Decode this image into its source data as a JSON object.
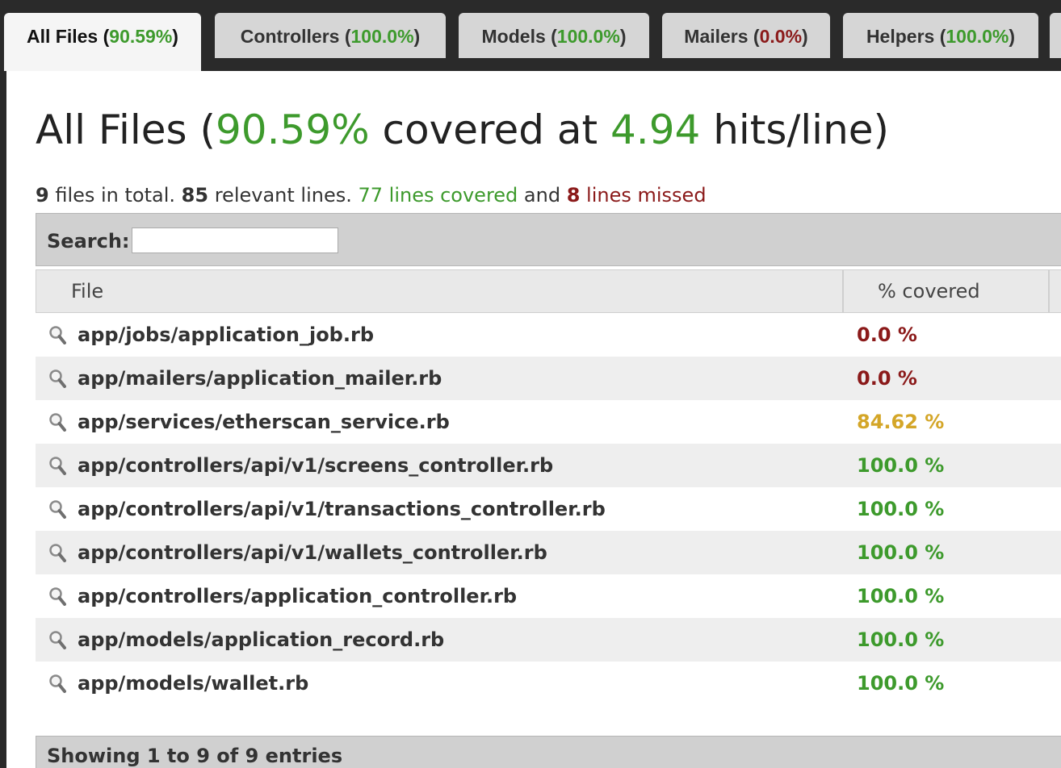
{
  "tabs": [
    {
      "label": "All Files (",
      "pct": "90.59%",
      "close": ")",
      "status": "green"
    },
    {
      "label": "Controllers (",
      "pct": "100.0%",
      "close": ")",
      "status": "green"
    },
    {
      "label": "Models (",
      "pct": "100.0%",
      "close": ")",
      "status": "green"
    },
    {
      "label": "Mailers (",
      "pct": "0.0%",
      "close": ")",
      "status": "red"
    },
    {
      "label": "Helpers (",
      "pct": "100.0%",
      "close": ")",
      "status": "green"
    }
  ],
  "title": {
    "prefix": "All Files (",
    "covered_pct": "90.59%",
    "mid": " covered at ",
    "hits": "4.94",
    "suffix": " hits/line)"
  },
  "summary": {
    "files_count": "9",
    "files_text": " files in total. ",
    "relevant_count": "85",
    "relevant_text": " relevant lines. ",
    "covered_text": "77 lines covered",
    "and_text": " and ",
    "missed_count": "8",
    "missed_text": " lines missed"
  },
  "search": {
    "label": "Search:",
    "value": ""
  },
  "table": {
    "headers": {
      "file": "File",
      "covered": "% covered"
    },
    "rows": [
      {
        "file": "app/jobs/application_job.rb",
        "pct": "0.0 %",
        "status": "red"
      },
      {
        "file": "app/mailers/application_mailer.rb",
        "pct": "0.0 %",
        "status": "red"
      },
      {
        "file": "app/services/etherscan_service.rb",
        "pct": "84.62 %",
        "status": "yellow"
      },
      {
        "file": "app/controllers/api/v1/screens_controller.rb",
        "pct": "100.0 %",
        "status": "green"
      },
      {
        "file": "app/controllers/api/v1/transactions_controller.rb",
        "pct": "100.0 %",
        "status": "green"
      },
      {
        "file": "app/controllers/api/v1/wallets_controller.rb",
        "pct": "100.0 %",
        "status": "green"
      },
      {
        "file": "app/controllers/application_controller.rb",
        "pct": "100.0 %",
        "status": "green"
      },
      {
        "file": "app/models/application_record.rb",
        "pct": "100.0 %",
        "status": "green"
      },
      {
        "file": "app/models/wallet.rb",
        "pct": "100.0 %",
        "status": "green"
      }
    ]
  },
  "footer": {
    "info": "Showing 1 to 9 of 9 entries"
  },
  "colors": {
    "green": "#3d9a2c",
    "red": "#8b1a1a",
    "yellow": "#d4a628"
  },
  "icons": {
    "row_icon": "magnifier-icon"
  }
}
